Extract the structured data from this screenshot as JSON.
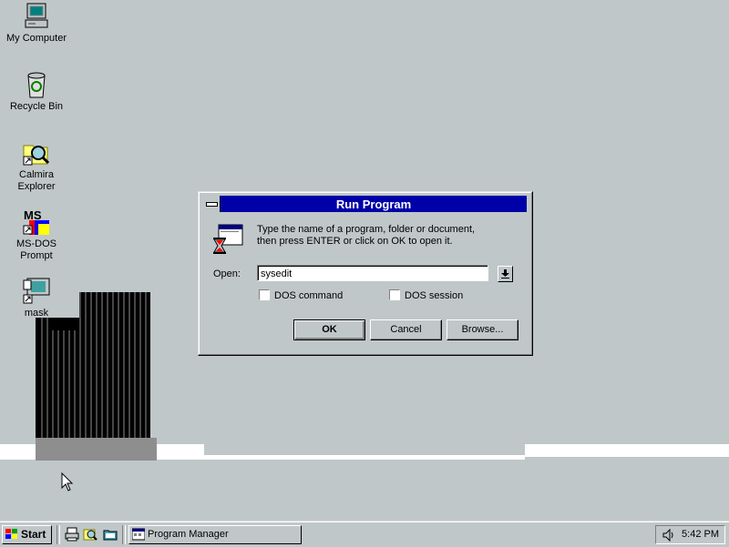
{
  "desktop": {
    "icons": [
      {
        "label": "My Computer",
        "icon": "my-computer-icon"
      },
      {
        "label": "Recycle Bin",
        "icon": "recycle-bin-icon"
      },
      {
        "label": "Calmira\nExplorer",
        "icon": "calmira-explorer-icon"
      },
      {
        "label": "MS-DOS\nPrompt",
        "icon": "ms-dos-prompt-icon"
      },
      {
        "label": "mask",
        "icon": "mask-icon"
      }
    ]
  },
  "dialog": {
    "title": "Run Program",
    "instruction_line1": "Type the name of a program, folder or document,",
    "instruction_line2": "then press ENTER or click on OK to open it.",
    "open_label": "Open:",
    "open_value": "sysedit",
    "dos_command_label": "DOS command",
    "dos_command_checked": false,
    "dos_session_label": "DOS session",
    "dos_session_checked": false,
    "ok_label": "OK",
    "cancel_label": "Cancel",
    "browse_label": "Browse..."
  },
  "taskbar": {
    "start_label": "Start",
    "quick_launch": [
      "printer-icon",
      "magnifier-icon",
      "folder-icon"
    ],
    "task_label": "Program Manager",
    "clock": "5:42 PM"
  },
  "colors": {
    "desktop": "#c0c7c8",
    "titlebar": "#0000a8"
  }
}
